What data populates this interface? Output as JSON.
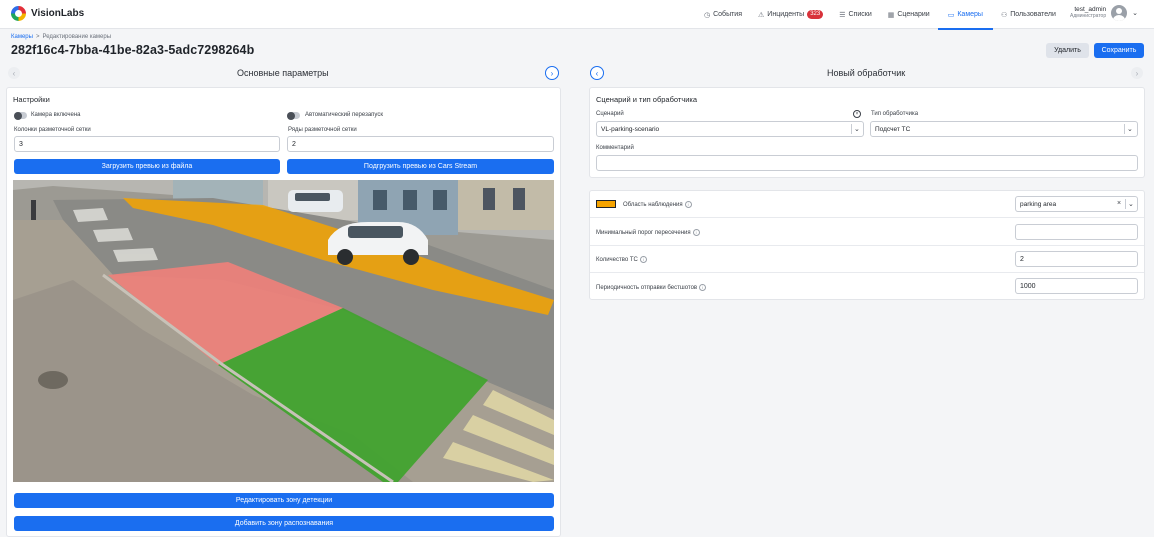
{
  "app": {
    "name": "VisionLabs"
  },
  "nav": {
    "items": [
      {
        "label": "События",
        "icon": "clock-icon"
      },
      {
        "label": "Инциденты",
        "icon": "warning-icon",
        "badge": "323"
      },
      {
        "label": "Списки",
        "icon": "list-icon"
      },
      {
        "label": "Сценарии",
        "icon": "scenario-icon"
      },
      {
        "label": "Камеры",
        "icon": "camera-icon",
        "active": true
      },
      {
        "label": "Пользователи",
        "icon": "users-icon"
      }
    ]
  },
  "user": {
    "name": "test_admin",
    "role": "Администратор"
  },
  "breadcrumb": {
    "root": "Камеры",
    "separator": ">",
    "current": "Редактирование камеры"
  },
  "page": {
    "title": "282f16c4-7bba-41be-82a3-5adc7298264b",
    "delete_label": "Удалить",
    "save_label": "Сохранить"
  },
  "left": {
    "title": "Основные параметры",
    "settings_title": "Настройки",
    "camera_enabled_label": "Камера включена",
    "auto_restart_label": "Автоматический перезапуск",
    "grid_cols_label": "Колонки разметочной сетки",
    "grid_cols_value": "3",
    "grid_rows_label": "Ряды разметочной сетки",
    "grid_rows_value": "2",
    "upload_preview_label": "Загрузить превью из файла",
    "load_stream_preview_label": "Подгрузить превью из Cars Stream",
    "edit_detection_label": "Редактировать зону детекции",
    "add_recognition_label": "Добавить зону распознавания"
  },
  "right": {
    "title": "Новый обработчик",
    "scenario_section_title": "Сценарий и тип обработчика",
    "scenario_label": "Сценарий",
    "scenario_value": "VL-parking-scenario",
    "handler_type_label": "Тип обработчика",
    "handler_type_value": "Подсчет ТС",
    "comment_label": "Комментарий",
    "comment_value": "",
    "observation_area_label": "Область наблюдения",
    "observation_area_value": "parking area",
    "observation_area_color": "#f5a300",
    "min_threshold_label": "Минимальный порог пересечения",
    "min_threshold_value": "",
    "vehicle_count_label": "Количество ТС",
    "vehicle_count_value": "2",
    "snapshot_period_label": "Периодичность отправки бестшотов",
    "snapshot_period_value": "1000"
  },
  "colors": {
    "accent": "#1a6ef0",
    "zone_red": "#f0807a",
    "zone_green": "#3fa32c",
    "zone_orange": "#f5a300"
  }
}
